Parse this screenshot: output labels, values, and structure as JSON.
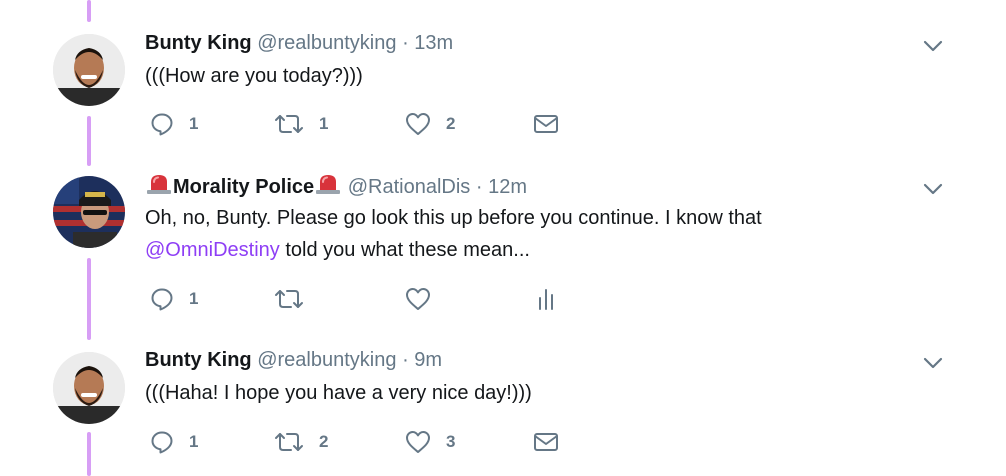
{
  "colors": {
    "thread_line": "#d79ef5",
    "mention": "#8e3ef5",
    "secondary": "#657786"
  },
  "tweets": [
    {
      "name": "Bunty King",
      "name_prefix_icon": "",
      "name_suffix_icon": "",
      "handle": "@realbuntyking",
      "dot": "·",
      "time": "13m",
      "text": "(((How are you today?)))",
      "replies": "1",
      "retweets": "1",
      "likes": "2",
      "last_action_icon": "envelope-icon"
    },
    {
      "name": "Morality Police",
      "name_prefix_icon": "police-siren-icon",
      "name_suffix_icon": "police-siren-icon",
      "handle": "@RationalDis",
      "dot": "·",
      "time": "12m",
      "text_line1": "Oh, no, Bunty. Please go look this up before you continue. I know that",
      "mention": "@OmniDestiny",
      "text_line2_rest": " told you what these mean...",
      "replies": "1",
      "retweets": "",
      "likes": "",
      "last_action_icon": "analytics-icon"
    },
    {
      "name": "Bunty King",
      "name_prefix_icon": "",
      "name_suffix_icon": "",
      "handle": "@realbuntyking",
      "dot": "·",
      "time": "9m",
      "text": "(((Haha! I hope you have a very nice day!)))",
      "replies": "1",
      "retweets": "2",
      "likes": "3",
      "last_action_icon": "envelope-icon"
    }
  ]
}
